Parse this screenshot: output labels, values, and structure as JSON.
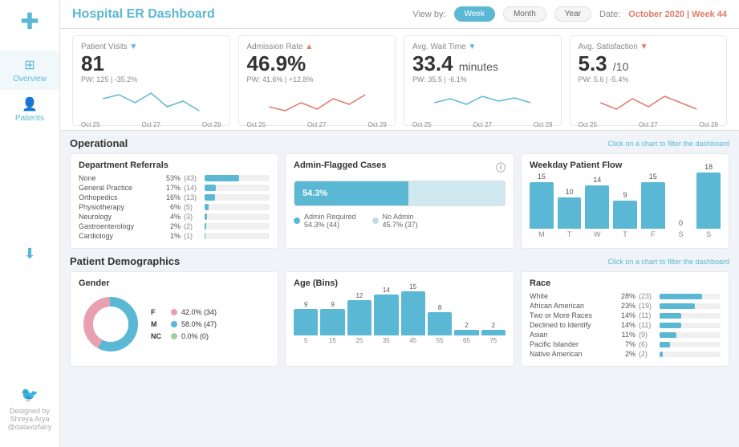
{
  "sidebar": {
    "nav": [
      {
        "label": "Overview",
        "active": true
      },
      {
        "label": "Patients",
        "active": false
      }
    ],
    "credit": {
      "designer": "Designed by",
      "name": "Shreya Arya",
      "handle": "@datavizfairy"
    }
  },
  "header": {
    "title": "Hospital ER Dashboard",
    "view_by_label": "View by:",
    "view_buttons": [
      "Week",
      "Month",
      "Year"
    ],
    "active_view": "Week",
    "date_label": "Date:",
    "date_value": "October 2020 | Week 44"
  },
  "kpi": [
    {
      "label": "Patient Visits",
      "trend": "down",
      "value": "81",
      "prev_label": "PW: 125 | -35.2%",
      "sparkline": "down"
    },
    {
      "label": "Admission Rate",
      "trend": "up",
      "value": "46.9%",
      "prev_label": "PW: 41.6% | +12.8%",
      "sparkline": "up"
    },
    {
      "label": "Avg. Wait Time",
      "trend": "down",
      "value": "33.4",
      "value_suffix": "minutes",
      "prev_label": "PW: 35.5 | -6.1%",
      "sparkline": "down"
    },
    {
      "label": "Avg. Satisfaction",
      "trend": "down",
      "value": "5.3",
      "value_suffix": "/10",
      "prev_label": "PW: 5.6 | -5.4%",
      "sparkline": "mixed"
    }
  ],
  "operational": {
    "title": "Operational",
    "hint": "Click on a chart to filter the dashboard",
    "dept_referrals": {
      "title": "Department Referrals",
      "rows": [
        {
          "name": "None",
          "pct": "53%",
          "count": "(43)",
          "bar": 53
        },
        {
          "name": "General Practice",
          "pct": "17%",
          "count": "(14)",
          "bar": 17
        },
        {
          "name": "Orthopedics",
          "pct": "16%",
          "count": "(13)",
          "bar": 16
        },
        {
          "name": "Physiotherapy",
          "pct": "6%",
          "count": "(5)",
          "bar": 6
        },
        {
          "name": "Neurology",
          "pct": "4%",
          "count": "(3)",
          "bar": 4
        },
        {
          "name": "Gastroenterology",
          "pct": "2%",
          "count": "(2)",
          "bar": 2
        },
        {
          "name": "Cardiology",
          "pct": "1%",
          "count": "(1)",
          "bar": 1
        }
      ]
    },
    "admin_flagged": {
      "title": "Admin-Flagged Cases",
      "admin_pct": 54.3,
      "admin_label": "54.3%",
      "no_admin_pct": 45.7,
      "legend": [
        {
          "label": "Admin Required",
          "sublabel": "54.3% (44)",
          "color": "#5bb8d4"
        },
        {
          "label": "No Admin",
          "sublabel": "45.7% (37)",
          "color": "#c0dce8"
        }
      ]
    },
    "weekday_flow": {
      "title": "Weekday Patient Flow",
      "bars": [
        {
          "day": "M",
          "value": 15
        },
        {
          "day": "T",
          "value": 10
        },
        {
          "day": "W",
          "value": 14
        },
        {
          "day": "T",
          "value": 9
        },
        {
          "day": "F",
          "value": 15
        },
        {
          "day": "S",
          "value": 0
        },
        {
          "day": "S",
          "value": 18
        }
      ],
      "max": 18
    }
  },
  "demographics": {
    "title": "Patient Demographics",
    "hint": "Click on a chart to filter the dashboard",
    "gender": {
      "title": "Gender",
      "items": [
        {
          "label": "F",
          "pct": "42.0% (34)",
          "color": "#e8a0b0",
          "value": 42
        },
        {
          "label": "M",
          "pct": "58.0% (47)",
          "color": "#5bb8d4",
          "value": 58
        },
        {
          "label": "NC",
          "pct": "0.0% (0)",
          "color": "#a0d0a0",
          "value": 0
        }
      ]
    },
    "age_bins": {
      "title": "Age (Bins)",
      "bars": [
        {
          "label": "5",
          "value": 9
        },
        {
          "label": "15",
          "value": 9
        },
        {
          "label": "25",
          "value": 12
        },
        {
          "label": "35",
          "value": 14
        },
        {
          "label": "45",
          "value": 15
        },
        {
          "label": "55",
          "value": 8
        },
        {
          "label": "65",
          "value": 2
        },
        {
          "label": "75",
          "value": 2
        }
      ],
      "max": 15
    },
    "race": {
      "title": "Race",
      "rows": [
        {
          "name": "White",
          "pct": "28%",
          "count": "(23)",
          "bar": 28
        },
        {
          "name": "African American",
          "pct": "23%",
          "count": "(19)",
          "bar": 23
        },
        {
          "name": "Two or More Races",
          "pct": "14%",
          "count": "(11)",
          "bar": 14
        },
        {
          "name": "Declined to Identify",
          "pct": "14%",
          "count": "(11)",
          "bar": 14
        },
        {
          "name": "Asian",
          "pct": "11%",
          "count": "(9)",
          "bar": 11
        },
        {
          "name": "Pacific Islander",
          "pct": "7%",
          "count": "(6)",
          "bar": 7
        },
        {
          "name": "Native American",
          "pct": "2%",
          "count": "(2)",
          "bar": 2
        }
      ]
    }
  }
}
